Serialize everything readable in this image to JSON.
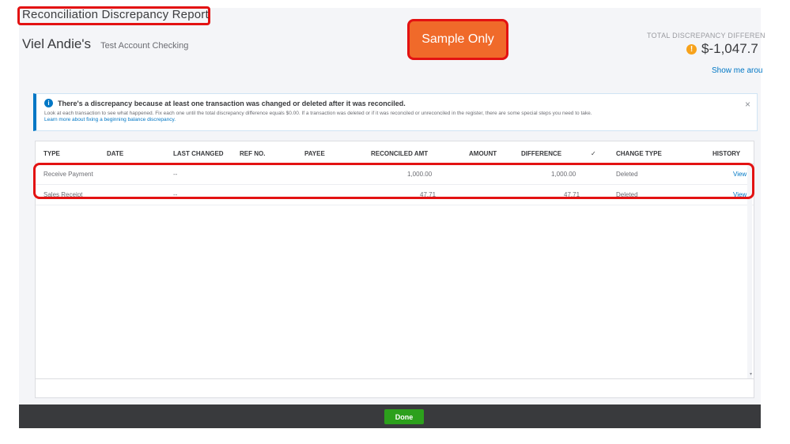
{
  "header": {
    "report_title": "Reconciliation Discrepancy Report",
    "account_name": "Viel Andie's",
    "account_type": "Test Account Checking",
    "sample_label": "Sample Only",
    "total_label": "TOTAL DISCREPANCY DIFFEREN",
    "total_value": "$-1,047.7",
    "show_me_link": "Show me arou"
  },
  "notice": {
    "headline": "There's a discrepancy because at least one transaction was changed or deleted after it was reconciled.",
    "body": "Look at each transaction to see what happened. Fix each one until the total discrepancy difference equals $0.00. If a transaction was deleted or if it was reconciled or unreconciled in the register, there are some special steps you need to take.",
    "link": "Learn more about fixing a beginning balance discrepancy.",
    "close": "×"
  },
  "table": {
    "columns": [
      "TYPE",
      "DATE",
      "LAST CHANGED",
      "REF NO.",
      "PAYEE",
      "RECONCILED AMT",
      "AMOUNT",
      "DIFFERENCE",
      "✓",
      "CHANGE TYPE",
      "HISTORY"
    ],
    "rows": [
      {
        "type": "Receive Payment",
        "date": "",
        "last_changed": "--",
        "ref_no": "",
        "payee": "",
        "reconciled_amt": "1,000.00",
        "amount": "",
        "difference": "1,000.00",
        "check": "",
        "change_type": "Deleted",
        "history": "View"
      },
      {
        "type": "Sales Receipt",
        "date": "",
        "last_changed": "--",
        "ref_no": "",
        "payee": "",
        "reconciled_amt": "47.71",
        "amount": "",
        "difference": "47.71",
        "check": "",
        "change_type": "Deleted",
        "history": "View"
      }
    ]
  },
  "footer": {
    "done_label": "Done"
  },
  "colors": {
    "accent_green": "#2ca01c",
    "link_blue": "#0077c5",
    "highlight_red": "#e31212",
    "sample_orange": "#f06a2a",
    "footer_dark": "#393a3d"
  }
}
